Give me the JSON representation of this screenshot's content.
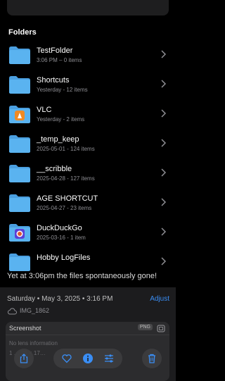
{
  "section_title": "Folders",
  "folders": [
    {
      "name": "TestFolder",
      "meta": "3:06 PM – 0 items",
      "icon": "folder-icon"
    },
    {
      "name": "Shortcuts",
      "meta": "Yesterday - 12 items",
      "icon": "folder-icon"
    },
    {
      "name": "VLC",
      "meta": "Yesterday - 2 items",
      "icon": "vlc-app-folder-icon"
    },
    {
      "name": "_temp_keep",
      "meta": "2025-05-01 - 124 items",
      "icon": "folder-icon"
    },
    {
      "name": "__scribble",
      "meta": "2025-04-28 - 127 items",
      "icon": "folder-icon"
    },
    {
      "name": "AGE SHORTCUT",
      "meta": "2025-04-27 - 23 items",
      "icon": "folder-icon"
    },
    {
      "name": "DuckDuckGo",
      "meta": "2025-03-16 - 1 item",
      "icon": "duckduckgo-app-folder-icon"
    },
    {
      "name": "Hobby LogFiles",
      "meta": "",
      "icon": "folder-icon"
    }
  ],
  "caption": "Yet at 3:06pm the files spontaneously gone!",
  "photo_info": {
    "date": "Saturday • May 3, 2025 • 3:16 PM",
    "adjust_label": "Adjust",
    "filename": "IMG_1862",
    "card_title": "Screenshot",
    "format_badge": "PNG",
    "lens": "No lens information",
    "dims": "1 … 28 × 17…"
  },
  "toolbar": {
    "icons": [
      "share-icon",
      "heart-icon",
      "info-icon",
      "adjust-sliders-icon",
      "trash-icon"
    ]
  },
  "colors": {
    "accent": "#3a8ef5",
    "folder_blue": "#5ab3f0",
    "bg": "#000000"
  }
}
